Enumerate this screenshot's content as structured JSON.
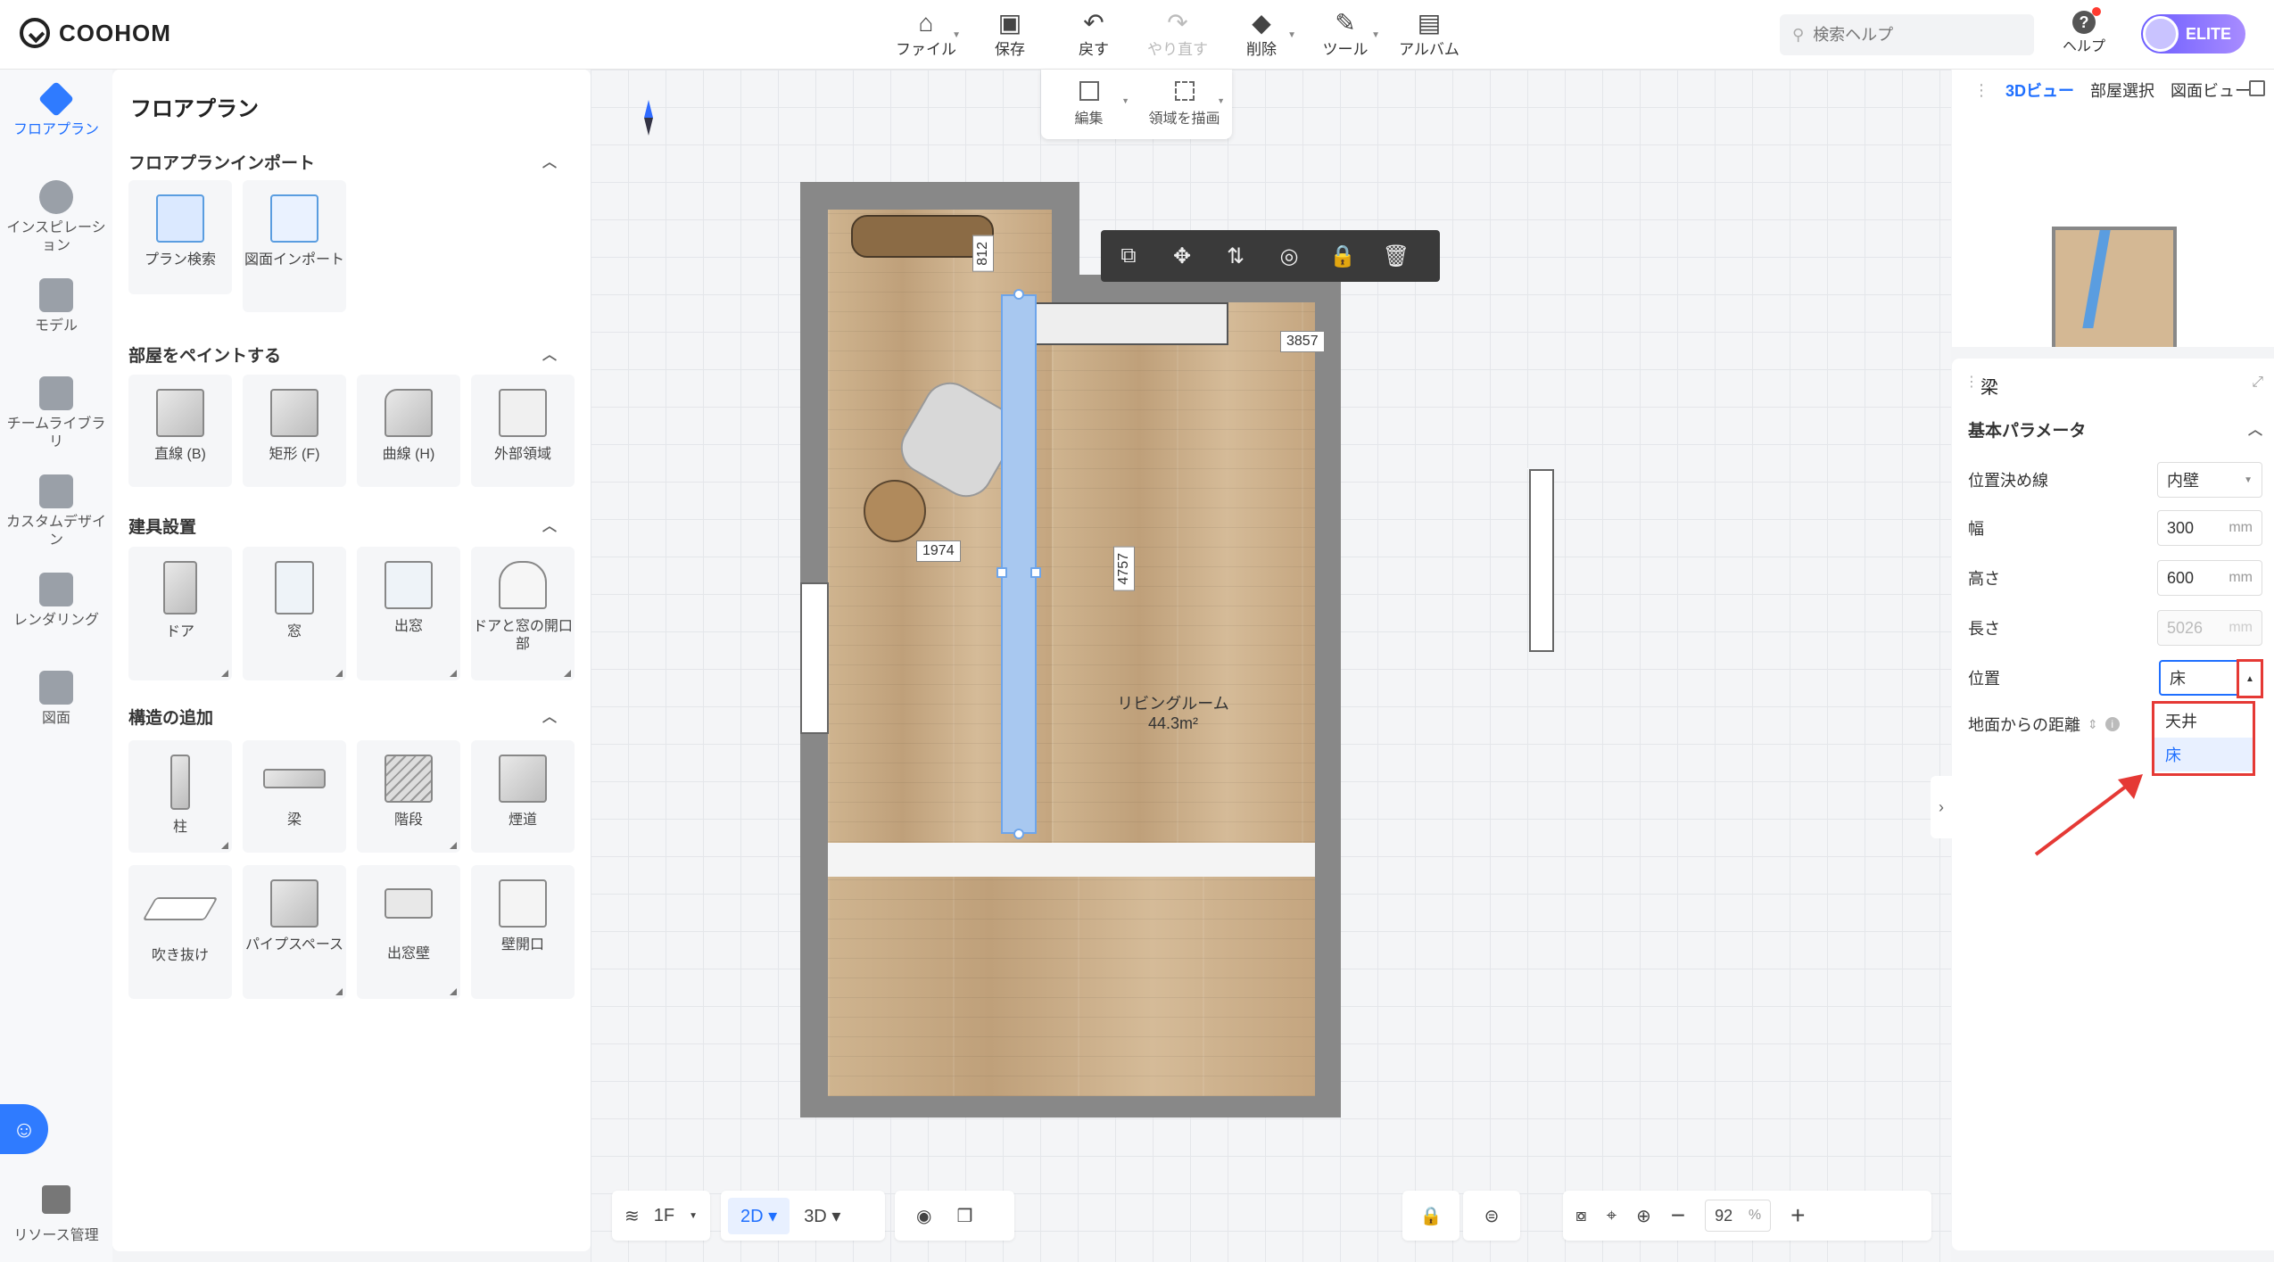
{
  "app": {
    "logo_text": "COOHOM"
  },
  "toolbar": {
    "file": "ファイル",
    "save": "保存",
    "undo": "戻す",
    "redo": "やり直す",
    "delete": "削除",
    "tools": "ツール",
    "album": "アルバム"
  },
  "search": {
    "placeholder": "検索ヘルプ"
  },
  "help": {
    "label": "ヘルプ"
  },
  "user": {
    "badge": "ELITE"
  },
  "leftnav": {
    "items": [
      {
        "label": "フロアプラン"
      },
      {
        "label": "インスピレーション"
      },
      {
        "label": "モデル"
      },
      {
        "label": "チームライブラリ"
      },
      {
        "label": "カスタムデザイン"
      },
      {
        "label": "レンダリング"
      },
      {
        "label": "図面"
      }
    ],
    "bottom": "リソース管理"
  },
  "library": {
    "title": "フロアプラン",
    "sections": [
      {
        "title": "フロアプランインポート",
        "items": [
          "プラン検索",
          "図面インポート"
        ]
      },
      {
        "title": "部屋をペイントする",
        "items": [
          "直線 (B)",
          "矩形 (F)",
          "曲線 (H)",
          "外部領域"
        ]
      },
      {
        "title": "建具設置",
        "items": [
          "ドア",
          "窓",
          "出窓",
          "ドアと窓の開口部"
        ]
      },
      {
        "title": "構造の追加",
        "items": [
          "柱",
          "梁",
          "階段",
          "煙道",
          "吹き抜け",
          "パイプスペース",
          "出窓壁",
          "壁開口"
        ]
      }
    ]
  },
  "canvas": {
    "subtools": [
      "編集",
      "領域を描画"
    ],
    "dims": {
      "top_short": "812",
      "beam_right": "3857",
      "table": "1974",
      "beam_length": "4757"
    },
    "room_name": "リビングルーム",
    "room_area": "44.3m²"
  },
  "bottombar": {
    "floor": "1F",
    "mode_2d": "2D",
    "mode_3d": "3D",
    "zoom_value": "92",
    "zoom_unit": "%"
  },
  "rightpanel": {
    "tabs": [
      "3Dビュー",
      "部屋選択",
      "図面ビュー"
    ],
    "props_title": "梁",
    "basic_params": "基本パラメータ",
    "rows": {
      "position_line_label": "位置決め線",
      "position_line_value": "内壁",
      "width_label": "幅",
      "width_value": "300",
      "height_label": "高さ",
      "height_value": "600",
      "length_label": "長さ",
      "length_value": "5026",
      "position_label": "位置",
      "position_value": "床",
      "distance_label": "地面からの距離",
      "unit": "mm"
    },
    "dropdown_options": [
      "天井",
      "床"
    ]
  }
}
